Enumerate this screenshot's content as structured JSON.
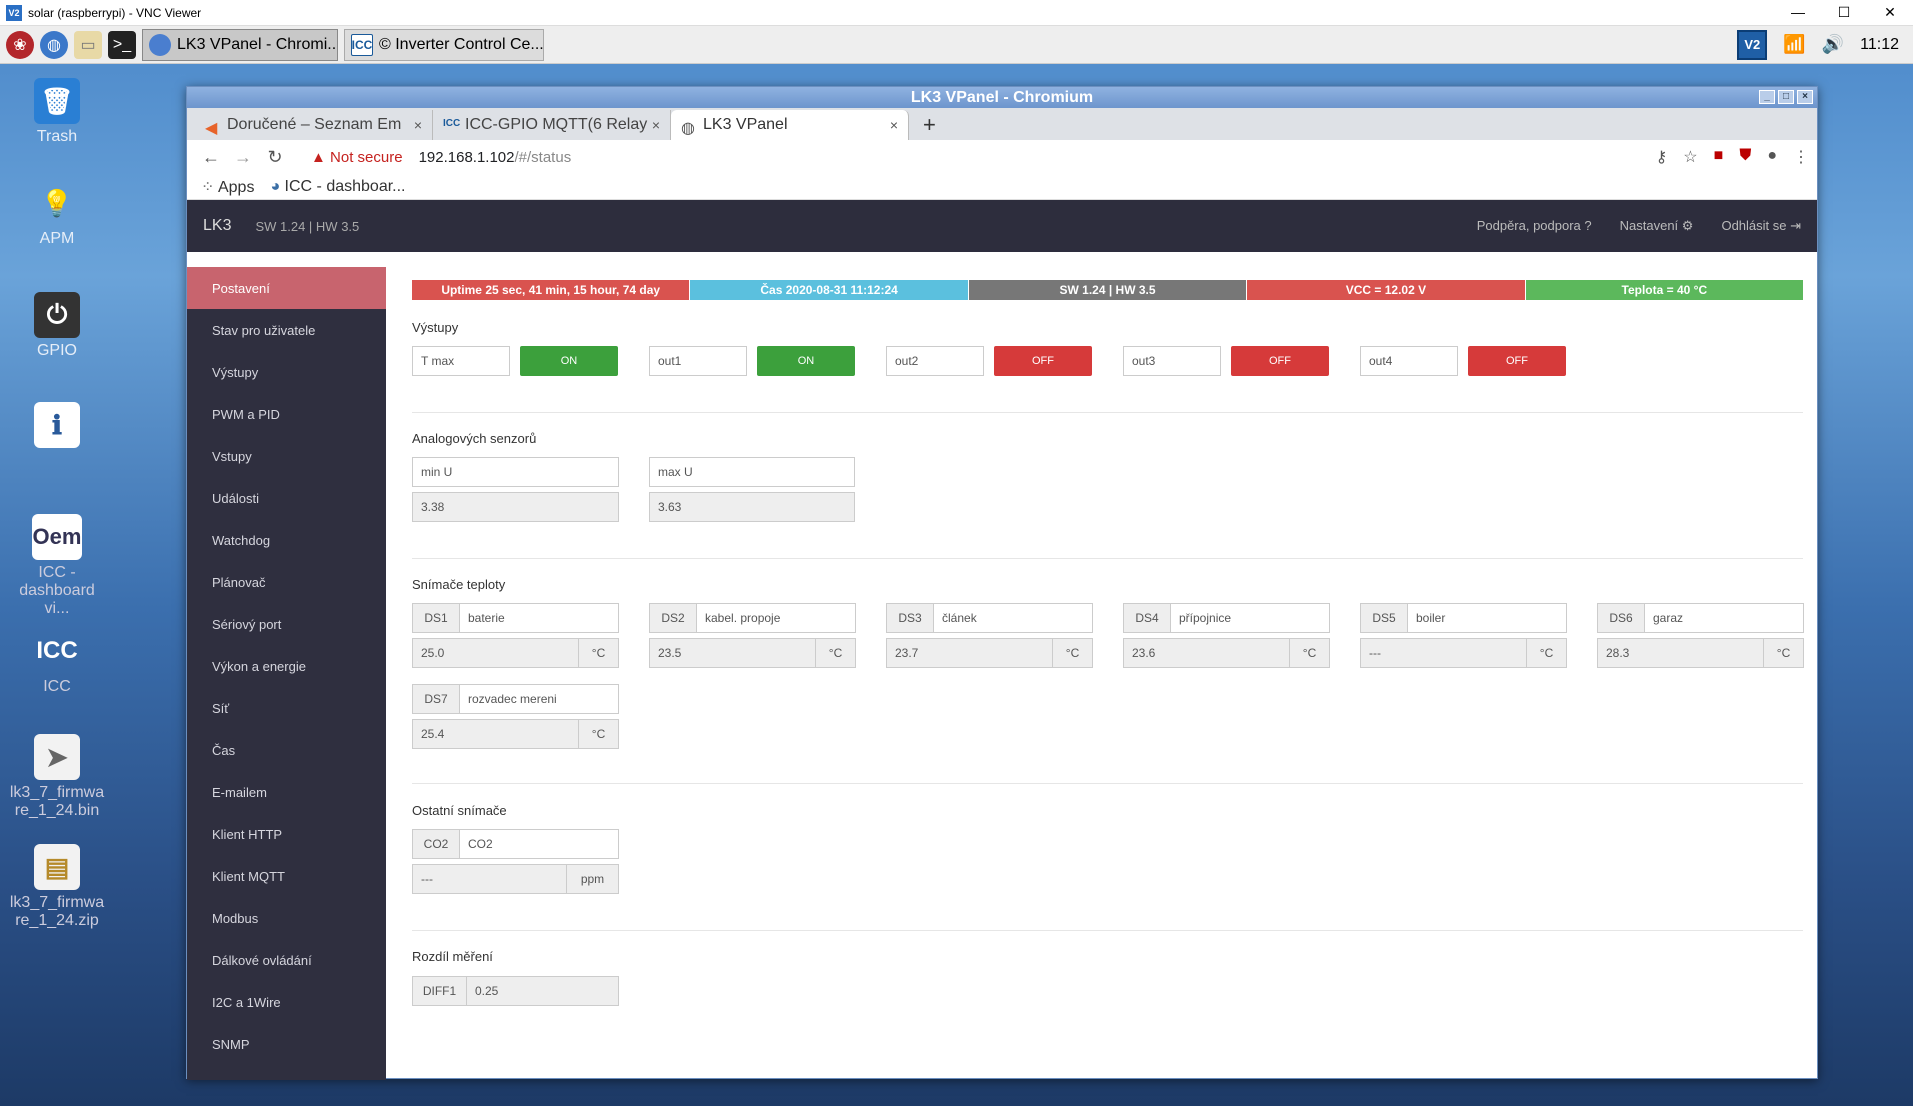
{
  "vnc": {
    "title": "solar (raspberrypi) - VNC Viewer",
    "logo": "V2"
  },
  "taskbar": {
    "tasks": [
      "LK3 VPanel - Chromi...",
      "© Inverter Control Ce..."
    ],
    "icc_mark": "ICC",
    "tray_vnc": "V2",
    "clock": "11:12"
  },
  "desktop": {
    "icons": [
      "Trash",
      "APM",
      "GPIO",
      "ICC - dashboard vi...",
      "ICC",
      "lk3_7_firmware_1_24.bin",
      "lk3_7_firmware_1_24.zip"
    ],
    "oem_text": "Oem",
    "icc_text": "ICC"
  },
  "browser": {
    "window_title": "LK3 VPanel - Chromium",
    "tabs": [
      "Doručené – Seznam Em",
      "ICC-GPIO MQTT(6 Relay",
      "LK3 VPanel"
    ],
    "tab_close": "×",
    "new_tab": "+",
    "security": "Not secure",
    "url_host": "192.168.1.102",
    "url_path": "/#/status",
    "bookmarks": [
      "Apps",
      "ICC - dashboar..."
    ]
  },
  "app": {
    "brand": "LK3",
    "version": "SW 1.24 | HW 3.5",
    "header_links": [
      "Podpěra, podpora ?",
      "Nastavení ⚙",
      "Odhlásit se ⇥"
    ],
    "sidebar": [
      "Postavení",
      "Stav pro uživatele",
      "Výstupy",
      "PWM a PID",
      "Vstupy",
      "Události",
      "Watchdog",
      "Plánovač",
      "Sériový port",
      "Výkon a energie",
      "Síť",
      "Čas",
      "E-mailem",
      "Klient HTTP",
      "Klient MQTT",
      "Modbus",
      "Dálkové ovládání",
      "I2C a 1Wire",
      "SNMP"
    ],
    "status": {
      "uptime": "Uptime 25 sec, 41 min, 15 hour, 74 day",
      "time": "Čas 2020-08-31 11:12:24",
      "sw": "SW 1.24 | HW 3.5",
      "vcc": "VCC = 12.02 V",
      "temp": "Teplota = 40 °C"
    },
    "colors": {
      "red": "#d9534f",
      "blue": "#5bc0de",
      "gray": "#777777",
      "green": "#5cb85c",
      "sidebar": "#2f2f3f",
      "active": "#c8646e"
    },
    "outputs": {
      "title": "Výstupy",
      "items": [
        {
          "name": "T max",
          "state": "ON"
        },
        {
          "name": "out1",
          "state": "ON"
        },
        {
          "name": "out2",
          "state": "OFF"
        },
        {
          "name": "out3",
          "state": "OFF"
        },
        {
          "name": "out4",
          "state": "OFF"
        }
      ]
    },
    "analog": {
      "title": "Analogových senzorů",
      "items": [
        {
          "name": "min U",
          "value": "3.38"
        },
        {
          "name": "max U",
          "value": "3.63"
        }
      ]
    },
    "temps": {
      "title": "Snímače teploty",
      "unit": "°C",
      "items": [
        {
          "id": "DS1",
          "name": "baterie",
          "value": "25.0"
        },
        {
          "id": "DS2",
          "name": "kabel. propoje",
          "value": "23.5"
        },
        {
          "id": "DS3",
          "name": "článek",
          "value": "23.7"
        },
        {
          "id": "DS4",
          "name": "přípojnice",
          "value": "23.6"
        },
        {
          "id": "DS5",
          "name": "boiler",
          "value": "---"
        },
        {
          "id": "DS6",
          "name": "garaz",
          "value": "28.3"
        },
        {
          "id": "DS7",
          "name": "rozvadec mereni",
          "value": "25.4"
        }
      ]
    },
    "other": {
      "title": "Ostatní snímače",
      "id": "CO2",
      "name": "CO2",
      "value": "---",
      "unit": "ppm"
    },
    "diff": {
      "title": "Rozdíl měření",
      "id": "DIFF1",
      "value": "0.25"
    }
  }
}
